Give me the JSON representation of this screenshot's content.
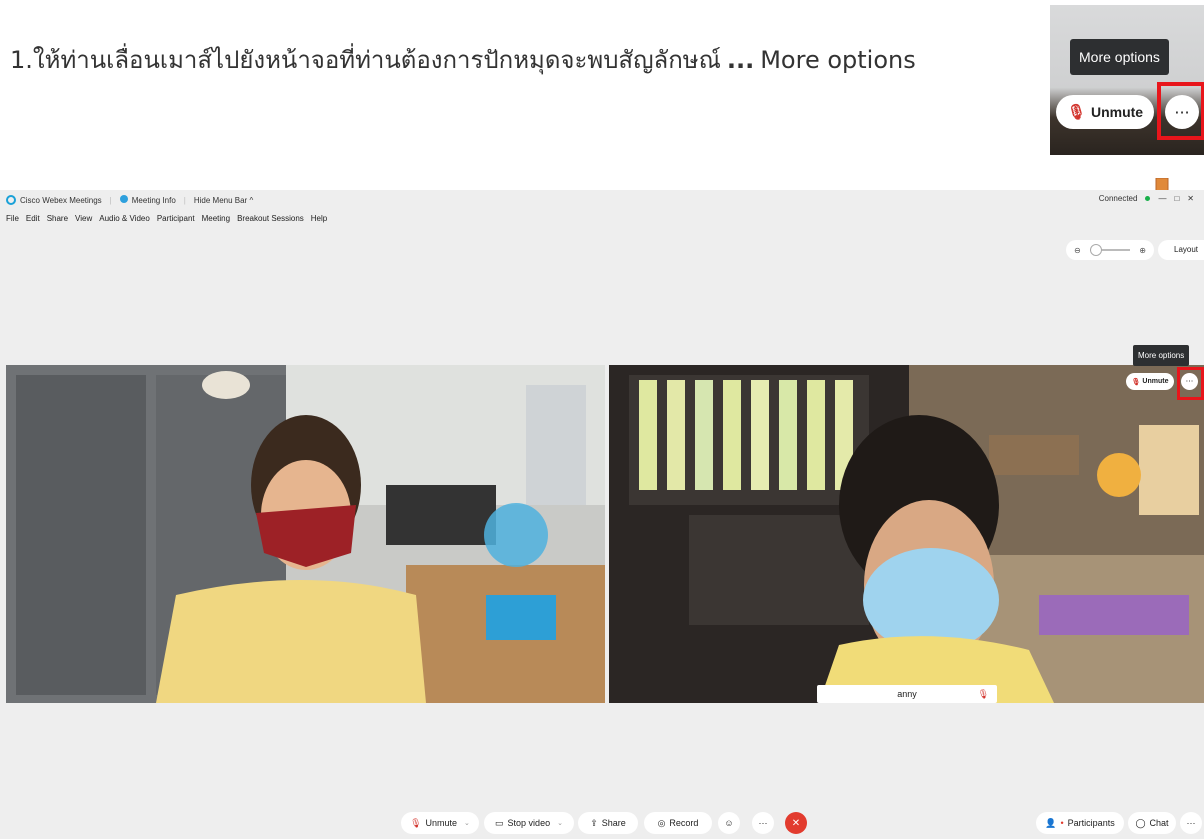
{
  "instruction": {
    "text": "1.ให้ท่านเลื่อนเมาส์ไปยังหน้าจอที่ท่านต้องการปักหมุดจะพบสัญลักษณ์",
    "dots": "...",
    "more_options": "More options"
  },
  "zoom_inset": {
    "tooltip": "More options",
    "unmute_label": "Unmute",
    "more_label": "···"
  },
  "titlebar": {
    "app_name": "Cisco Webex Meetings",
    "meeting_info": "Meeting Info",
    "hide_menu_bar": "Hide Menu Bar",
    "hide_caret": "^",
    "status": "Connected",
    "minimize": "—",
    "maximize": "□",
    "close": "✕"
  },
  "menubar": [
    "File",
    "Edit",
    "Share",
    "View",
    "Audio & Video",
    "Participant",
    "Meeting",
    "Breakout Sessions",
    "Help"
  ],
  "zoom_control": {
    "zoom_out": "⊖",
    "zoom_in": "⊕"
  },
  "layout_label": "Layout",
  "video_tile": {
    "tooltip": "More options",
    "unmute_label": "Unmute",
    "more_label": "···",
    "participant_name": "anny"
  },
  "bottombar": {
    "unmute": "Unmute",
    "stop_video": "Stop video",
    "share": "Share",
    "record": "Record",
    "emoji": "☺",
    "more": "···",
    "end": "✕",
    "participants": "Participants",
    "chat": "Chat",
    "more_right": "···"
  },
  "colors": {
    "accent_red": "#e8151b",
    "arrow_orange": "#e0893a",
    "end_button": "#e23b2e",
    "tooltip_bg": "#2d2f31"
  }
}
